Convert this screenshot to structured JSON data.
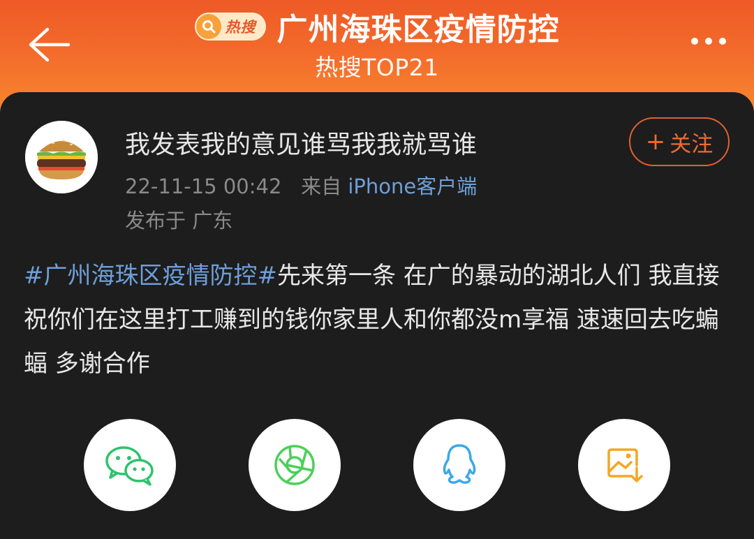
{
  "header": {
    "badge_label": "热搜",
    "title": "广州海珠区疫情防控",
    "subtitle": "热搜TOP21"
  },
  "post": {
    "username": "我发表我的意见谁骂我我就骂谁",
    "time": "22-11-15 00:42",
    "source_prefix": "来自",
    "source": "iPhone客户端",
    "location": "发布于 广东",
    "follow_label": "关注",
    "hashtag": "#广州海珠区疫情防控#",
    "body": "先来第一条 在广的暴动的湖北人们  我直接祝你们在这里打工赚到的钱你家里人和你都没m享福 速速回去吃蝙蝠 多谢合作"
  },
  "share": [
    {
      "icon": "wechat-icon"
    },
    {
      "icon": "moments-icon"
    },
    {
      "icon": "qq-icon"
    },
    {
      "icon": "save-image-icon"
    }
  ],
  "colors": {
    "header_orange": "#f36a2b",
    "card_bg": "#1d1d1e",
    "link_blue": "#6f9fd8",
    "follow_orange": "#f06a2d",
    "wechat_green": "#2ec26b",
    "moments_green": "#4ccf5a",
    "qq_blue": "#3aa8e8",
    "save_orange": "#f5a623"
  }
}
